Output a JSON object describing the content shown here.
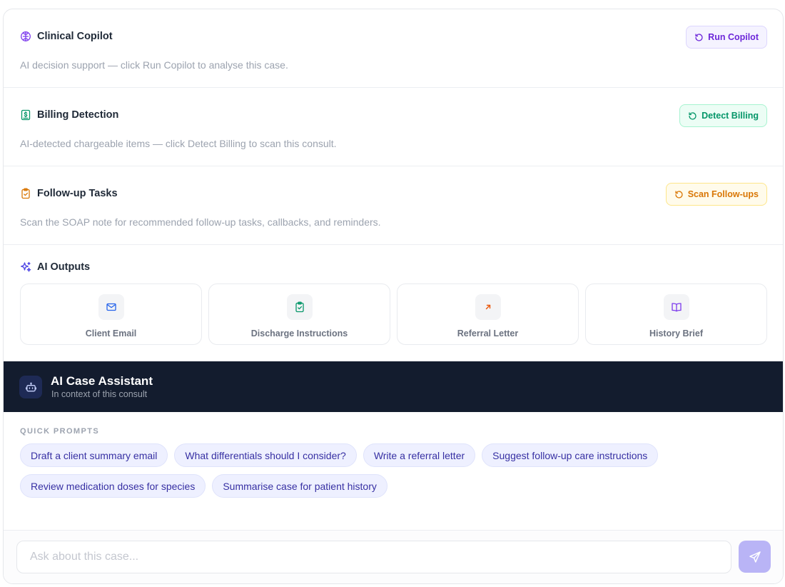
{
  "copilot": {
    "title": "Clinical Copilot",
    "description": "AI decision support — click Run Copilot to analyse this case.",
    "button_label": "Run Copilot"
  },
  "billing": {
    "title": "Billing Detection",
    "description": "AI-detected chargeable items — click Detect Billing to scan this consult.",
    "button_label": "Detect Billing"
  },
  "followup": {
    "title": "Follow-up Tasks",
    "description": "Scan the SOAP note for recommended follow-up tasks, callbacks, and reminders.",
    "button_label": "Scan Follow-ups"
  },
  "outputs": {
    "title": "AI Outputs",
    "cards": [
      {
        "label": "Client Email",
        "icon": "mail-icon"
      },
      {
        "label": "Discharge Instructions",
        "icon": "clipboard-check-icon"
      },
      {
        "label": "Referral Letter",
        "icon": "arrow-up-right-icon"
      },
      {
        "label": "History Brief",
        "icon": "book-open-icon"
      }
    ]
  },
  "assistant": {
    "title": "AI Case Assistant",
    "subtitle": "In context of this consult",
    "prompts_label": "QUICK PROMPTS",
    "prompts": [
      "Draft a client summary email",
      "What differentials should I consider?",
      "Write a referral letter",
      "Suggest follow-up care instructions",
      "Review medication doses for species",
      "Summarise case for patient history"
    ],
    "input_placeholder": "Ask about this case..."
  },
  "colors": {
    "purple": "#7c3aed",
    "green": "#059669",
    "amber": "#d97706",
    "dark_bar": "#131c2e",
    "chip_text": "#3730a3",
    "send_button": "#b9b4f6"
  }
}
